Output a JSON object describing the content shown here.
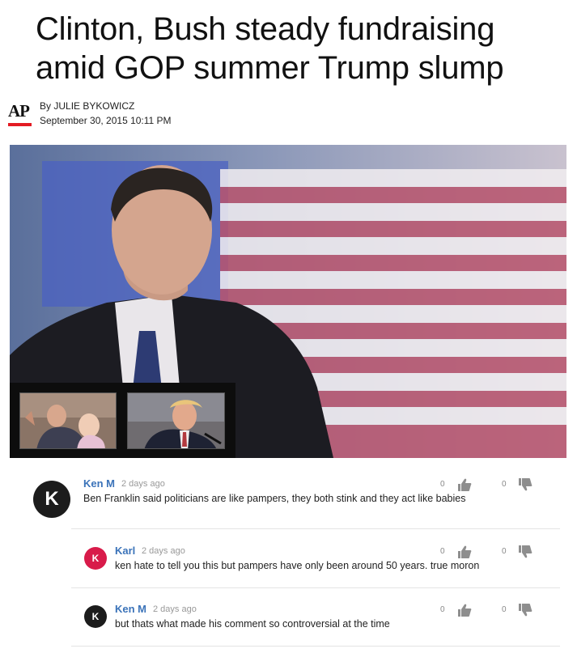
{
  "article": {
    "headline_line1": "Clinton, Bush steady fundraising",
    "headline_line2": "amid GOP summer Trump slump",
    "byline_prefix": "By",
    "author": "JULIE BYKOWICZ",
    "date": "September 30, 2015 10:11 PM",
    "source_logo": "AP"
  },
  "media": {
    "hero_icon": "photo",
    "thumbnails": [
      "photo-thumbnail",
      "photo-thumbnail"
    ]
  },
  "comments": [
    {
      "avatar_letter": "K",
      "avatar_color": "#1c1c1c",
      "author": "Ken M",
      "time": "2 days ago",
      "text": "Ben Franklin said politicians are like pampers, they both stink and they act like babies",
      "upvotes": "0",
      "downvotes": "0"
    },
    {
      "avatar_letter": "K",
      "avatar_color": "#d81b4a",
      "author": "Karl",
      "time": "2 days ago",
      "text": "ken hate to tell you this but pampers have only been around 50 years. true moron",
      "upvotes": "0",
      "downvotes": "0"
    },
    {
      "avatar_letter": "K",
      "avatar_color": "#1c1c1c",
      "author": "Ken M",
      "time": "2 days ago",
      "text": "but thats what made his comment so controversial at the time",
      "upvotes": "0",
      "downvotes": "0"
    }
  ],
  "colors": {
    "author_link": "#3b73b9",
    "ap_red": "#e31b23"
  }
}
